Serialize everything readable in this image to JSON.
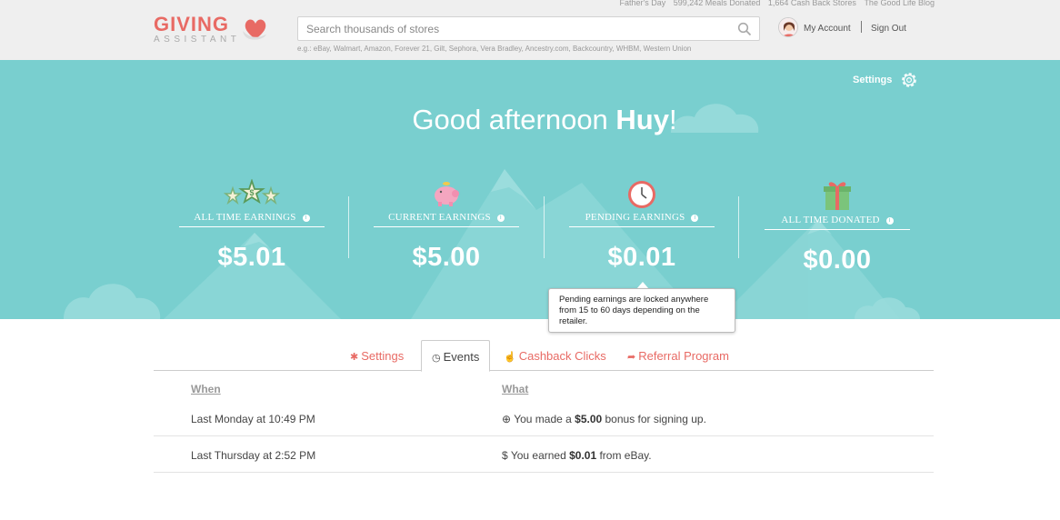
{
  "top_links": [
    "Father's Day",
    "599,242 Meals Donated",
    "1,664 Cash Back Stores",
    "The Good Life Blog"
  ],
  "logo": {
    "word": "GIVING",
    "sub": "ASSISTANT"
  },
  "search": {
    "placeholder": "Search thousands of stores",
    "hint": "e.g.: eBay, Walmart, Amazon, Forever 21, Gilt, Sephora, Vera Bradley, Ancestry.com, Backcountry, WHBM, Western Union"
  },
  "account": {
    "my_account": "My Account",
    "sign_out": "Sign Out"
  },
  "hero": {
    "settings_label": "Settings",
    "greeting_prefix": "Good afternoon ",
    "user_name": "Huy",
    "greeting_suffix": "!",
    "stats": [
      {
        "label": "ALL TIME EARNINGS",
        "value": "$5.01",
        "icon": "stars-icon"
      },
      {
        "label": "CURRENT EARNINGS",
        "value": "$5.00",
        "icon": "piggy-bank-icon"
      },
      {
        "label": "PENDING EARNINGS",
        "value": "$0.01",
        "icon": "clock-icon"
      },
      {
        "label": "ALL TIME DONATED",
        "value": "$0.00",
        "icon": "gift-icon"
      }
    ],
    "info_glyph": "i",
    "tooltip": "Pending earnings are locked anywhere from 15 to 60 days depending on the retailer."
  },
  "tabs": [
    {
      "label": "Settings",
      "glyph": "✱"
    },
    {
      "label": "Events",
      "glyph": "◷"
    },
    {
      "label": "Cashback Clicks",
      "glyph": "☝"
    },
    {
      "label": "Referral Program",
      "glyph": "➦"
    }
  ],
  "events": {
    "columns": [
      "When",
      "What"
    ],
    "rows": [
      {
        "when": "Last Monday at 10:49 PM",
        "glyph": "⊕",
        "pre": "You made a ",
        "amount": "$5.00",
        "post": " bonus for signing up."
      },
      {
        "when": "Last Thursday at 2:52 PM",
        "glyph": "$",
        "pre": "You earned ",
        "amount": "$0.01",
        "post": " from eBay."
      }
    ]
  },
  "colors": {
    "accent": "#e86a64",
    "hero_bg": "#79cfcf",
    "header_bg": "#efefef"
  }
}
